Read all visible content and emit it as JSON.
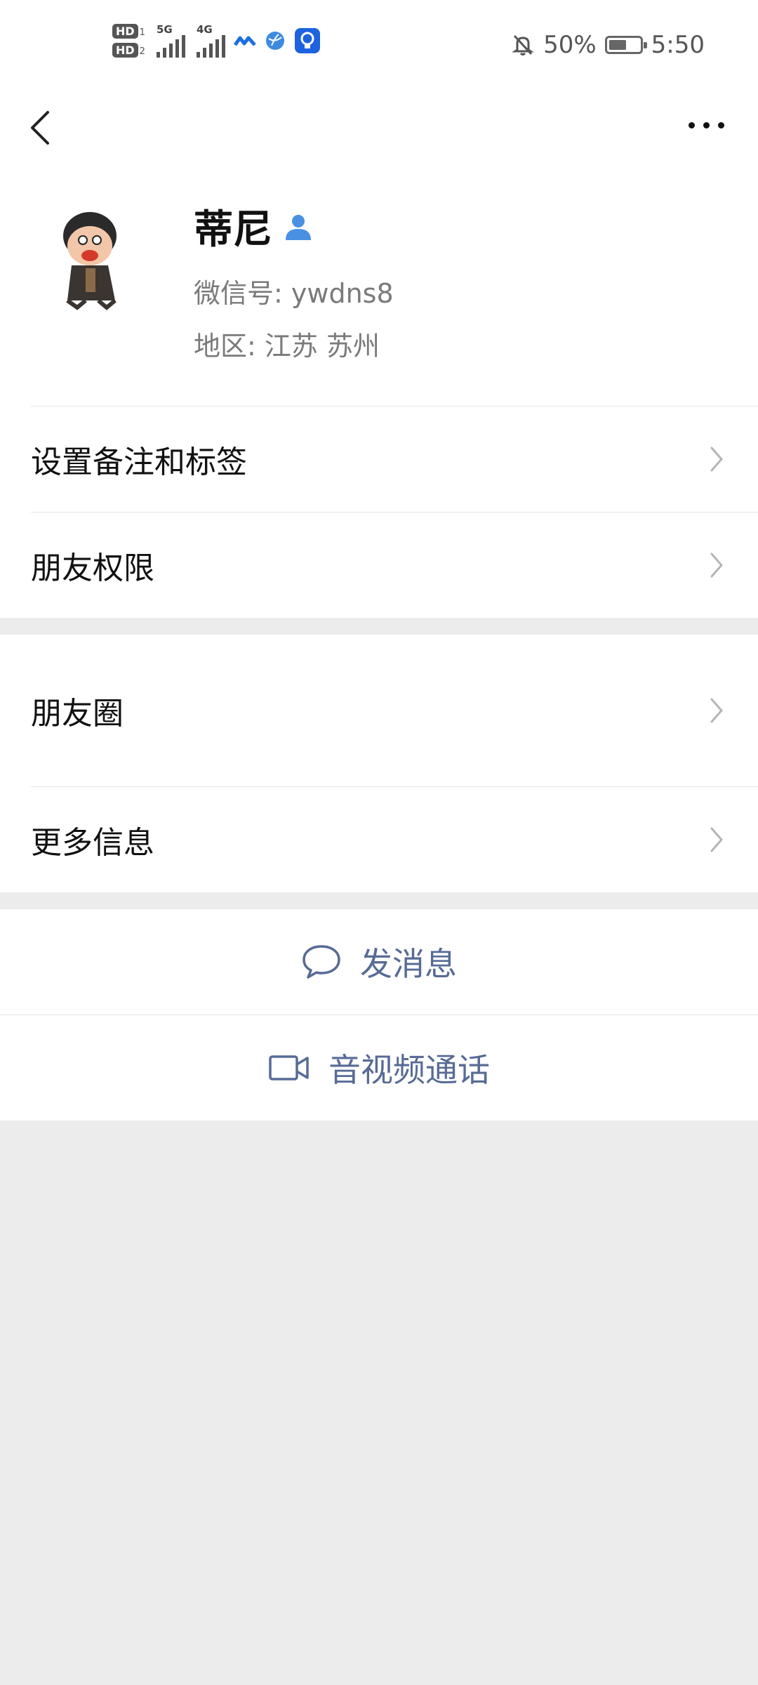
{
  "status_bar": {
    "hd1": "HD",
    "hd1_sub": "1",
    "hd2": "HD",
    "hd2_sub": "2",
    "net1": "5G",
    "net2": "4G",
    "battery_percent": "50%",
    "time": "5:50",
    "battery_level": 0.5
  },
  "nav": {
    "back_icon": "chevron-left-icon",
    "more_icon": "more-dots-icon"
  },
  "profile": {
    "name": "蒂尼",
    "wechat_id": "微信号: ywdns8",
    "region": "地区: 江苏  苏州"
  },
  "menu_group1": [
    {
      "label": "设置备注和标签"
    },
    {
      "label": "朋友权限"
    }
  ],
  "menu_group2": [
    {
      "label": "朋友圈"
    },
    {
      "label": "更多信息"
    }
  ],
  "actions": {
    "message_label": "发消息",
    "call_label": "音视频通话"
  },
  "colors": {
    "link": "#576b95",
    "accent_icon": "#4a90e2",
    "background": "#ececec"
  }
}
